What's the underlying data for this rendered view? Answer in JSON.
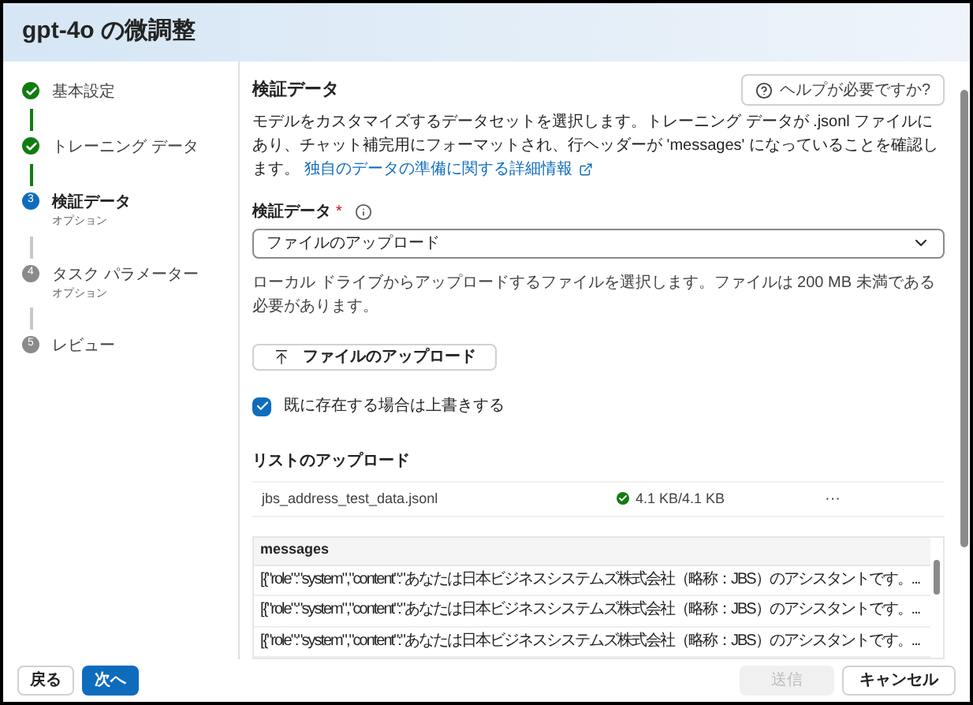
{
  "window": {
    "title": "gpt-4o の微調整"
  },
  "steps": [
    {
      "label": "基本設定",
      "completed": true,
      "selected": false
    },
    {
      "label": "トレーニング データ",
      "completed": true,
      "selected": false
    },
    {
      "number": "3",
      "label": "検証データ",
      "sublabel": "オプション",
      "completed": false,
      "selected": true
    },
    {
      "number": "4",
      "label": "タスク パラメーター",
      "sublabel": "オプション",
      "completed": false,
      "selected": false
    },
    {
      "number": "5",
      "label": "レビュー",
      "completed": false,
      "selected": false
    }
  ],
  "section_title": "検証データ",
  "help_button": "ヘルプが必要ですか?",
  "description": "モデルをカスタマイズするデータセットを選択します。トレーニング データが .jsonl ファイルにあり、チャット補完用にフォーマットされ、行ヘッダーが 'messages' になっていることを確認します。",
  "description_link": "独自のデータの準備に関する詳細情報",
  "field": {
    "label": "検証データ",
    "required_mark": "*",
    "value": "ファイルのアップロード"
  },
  "hint": "ローカル ドライブからアップロードするファイルを選択します。ファイルは 200 MB 未満である必要があります。",
  "upload_button": "ファイルのアップロード",
  "overwrite": {
    "label": "既に存在する場合は上書きする",
    "checked": true
  },
  "uploads": {
    "title": "リストのアップロード",
    "files": [
      {
        "name": "jbs_address_test_data.jsonl",
        "progress": "4.1 KB/4.1 KB",
        "done": true,
        "menu": "···"
      }
    ]
  },
  "preview": {
    "column": "messages",
    "rows": [
      "[{\"role\":\"system\",\"content\":\"あなたは日本ビジネスシステムズ株式会社（略称：JBS）のアシスタントです。...",
      "[{\"role\":\"system\",\"content\":\"あなたは日本ビジネスシステムズ株式会社（略称：JBS）のアシスタントです。...",
      "[{\"role\":\"system\",\"content\":\"あなたは日本ビジネスシステムズ株式会社（略称：JBS）のアシスタントです。..."
    ]
  },
  "footer": {
    "back": "戻る",
    "next": "次へ",
    "submit": {
      "label": "送信",
      "disabled": true
    },
    "cancel": "キャンセル"
  }
}
